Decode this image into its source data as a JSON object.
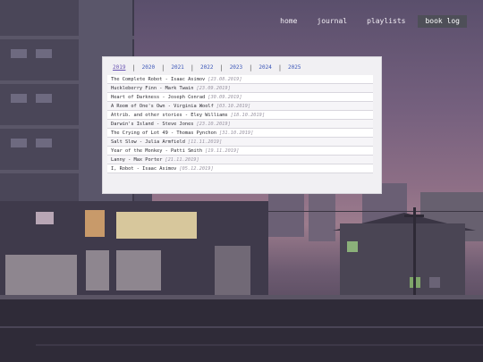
{
  "nav": {
    "items": [
      {
        "label": "home",
        "active": false
      },
      {
        "label": "journal",
        "active": false
      },
      {
        "label": "playlists",
        "active": false
      },
      {
        "label": "book log",
        "active": true
      }
    ]
  },
  "years": {
    "items": [
      "2019",
      "2020",
      "2021",
      "2022",
      "2023",
      "2024",
      "2025"
    ],
    "selected": "2019",
    "separator": "|"
  },
  "books": [
    {
      "entry": "The Complete Robot - Isaac Asimov",
      "date": "[23.08.2019]"
    },
    {
      "entry": "Huckleberry Finn - Mark Twain",
      "date": "[23.09.2019]"
    },
    {
      "entry": "Heart of Darkness - Joseph Conrad",
      "date": "[30.09.2019]"
    },
    {
      "entry": "A Room of One's Own - Virginia Woolf",
      "date": "[03.10.2019]"
    },
    {
      "entry": "Attrib. and other stories - Eley Williams",
      "date": "[18.10.2019]"
    },
    {
      "entry": "Darwin's Island - Steve Jones",
      "date": "[23.10.2019]"
    },
    {
      "entry": "The Crying of Lot 49 - Thomas Pynchon",
      "date": "[31.10.2019]"
    },
    {
      "entry": "Salt Slow - Julia Armfield",
      "date": "[11.11.2019]"
    },
    {
      "entry": "Year of the Monkey - Patti Smith",
      "date": "[19.11.2019]"
    },
    {
      "entry": "Lanny - Max Porter",
      "date": "[21.11.2019]"
    },
    {
      "entry": "I, Robot - Isaac Asimov",
      "date": "[05.12.2019]"
    }
  ],
  "colors": {
    "nav_active_bg": "#4e4f58",
    "link": "#3b56b8",
    "date": "#9a95a3"
  }
}
